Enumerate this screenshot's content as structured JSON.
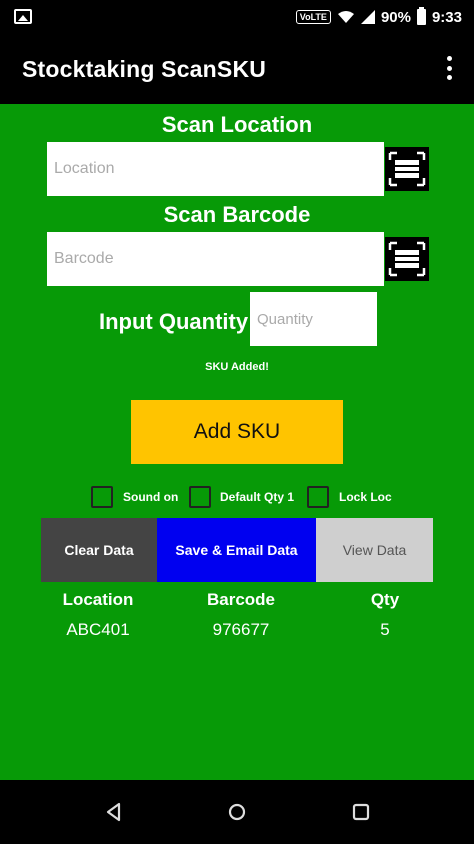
{
  "status_bar": {
    "volte": "VoLTE",
    "battery_pct": "90%",
    "time": "9:33"
  },
  "app_bar": {
    "title": "Stocktaking ScanSKU"
  },
  "location": {
    "label": "Scan Location",
    "placeholder": "Location",
    "value": ""
  },
  "barcode": {
    "label": "Scan Barcode",
    "placeholder": "Barcode",
    "value": ""
  },
  "quantity": {
    "label": "Input Quantity",
    "placeholder": "Quantity",
    "value": ""
  },
  "status_message": "SKU Added!",
  "add_button": "Add SKU",
  "options": [
    {
      "label": "Sound on",
      "checked": false
    },
    {
      "label": "Default Qty 1",
      "checked": false
    },
    {
      "label": "Lock Loc",
      "checked": false
    }
  ],
  "actions": {
    "clear": "Clear Data",
    "save": "Save & Email Data",
    "view": "View Data"
  },
  "table": {
    "headers": [
      "Location",
      "Barcode",
      "Qty"
    ],
    "rows": [
      [
        "ABC401",
        "976677",
        "5"
      ]
    ]
  },
  "colors": {
    "background": "#079a07",
    "add_button": "#ffc400",
    "save_button": "#0000f0",
    "clear_button": "#444444",
    "view_button": "#cfcfcf"
  }
}
